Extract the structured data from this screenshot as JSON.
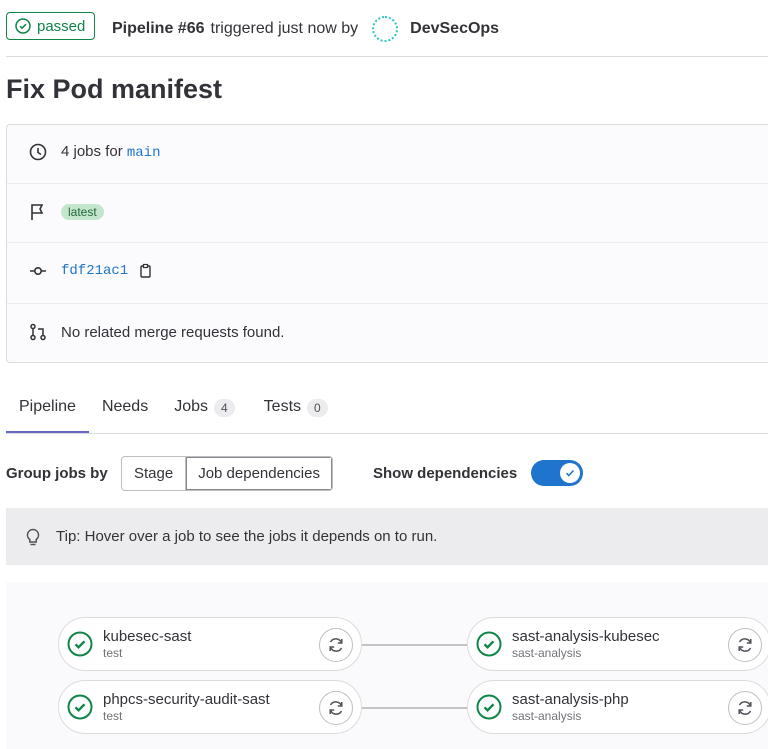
{
  "header": {
    "status": "passed",
    "pipeline": "Pipeline #66",
    "triggered": "triggered just now by",
    "user": "DevSecOps"
  },
  "title": "Fix Pod manifest",
  "info": {
    "jobs_text": "4 jobs for",
    "branch": "main",
    "tag": "latest",
    "commit": "fdf21ac1",
    "mr_text": "No related merge requests found."
  },
  "tabs": [
    {
      "label": "Pipeline"
    },
    {
      "label": "Needs"
    },
    {
      "label": "Jobs",
      "count": "4"
    },
    {
      "label": "Tests",
      "count": "0"
    }
  ],
  "controls": {
    "group_label": "Group jobs by",
    "stage": "Stage",
    "job_deps": "Job dependencies",
    "show_deps": "Show dependencies",
    "show_deps_on": true
  },
  "tip": "Tip: Hover over a job to see the jobs it depends on to run.",
  "jobs": [
    {
      "name": "kubesec-sast",
      "stage": "test"
    },
    {
      "name": "phpcs-security-audit-sast",
      "stage": "test"
    },
    {
      "name": "sast-analysis-kubesec",
      "stage": "sast-analysis"
    },
    {
      "name": "sast-analysis-php",
      "stage": "sast-analysis"
    }
  ],
  "colors": {
    "success": "#108548",
    "accent": "#1f75cb",
    "tab_active": "#6666c4"
  }
}
